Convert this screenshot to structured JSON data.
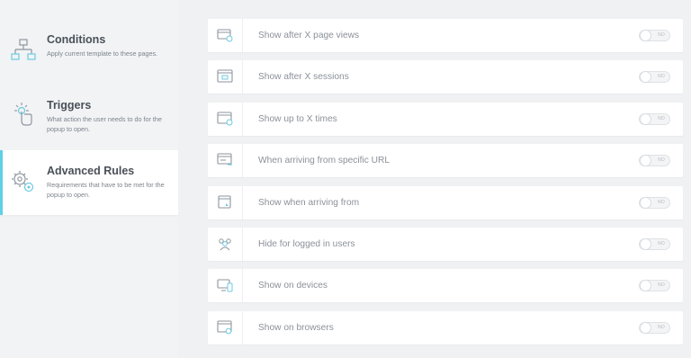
{
  "sidebar": {
    "items": [
      {
        "title": "Conditions",
        "description": "Apply current template to these pages.",
        "icon": "sitemap-icon"
      },
      {
        "title": "Triggers",
        "description": "What action the user needs to do for the popup to open.",
        "icon": "pointer-click-icon"
      },
      {
        "title": "Advanced Rules",
        "description": "Requirements that have to be met for the popup to open.",
        "icon": "gears-icon",
        "active": true
      }
    ]
  },
  "rules": [
    {
      "label": "Show after X page views",
      "icon": "page-views-icon",
      "toggle": "NO"
    },
    {
      "label": "Show after X sessions",
      "icon": "sessions-icon",
      "toggle": "NO"
    },
    {
      "label": "Show up to X times",
      "icon": "times-icon",
      "toggle": "NO"
    },
    {
      "label": "When arriving from specific URL",
      "icon": "url-icon",
      "toggle": "NO"
    },
    {
      "label": "Show when arriving from",
      "icon": "arriving-from-icon",
      "toggle": "NO"
    },
    {
      "label": "Hide for logged in users",
      "icon": "users-icon",
      "toggle": "NO"
    },
    {
      "label": "Show on devices",
      "icon": "devices-icon",
      "toggle": "NO"
    },
    {
      "label": "Show on browsers",
      "icon": "browsers-icon",
      "toggle": "NO"
    }
  ],
  "colors": {
    "accent": "#5fd0e6",
    "icon_stroke": "#8e969e",
    "icon_accent": "#6ec9e0"
  }
}
